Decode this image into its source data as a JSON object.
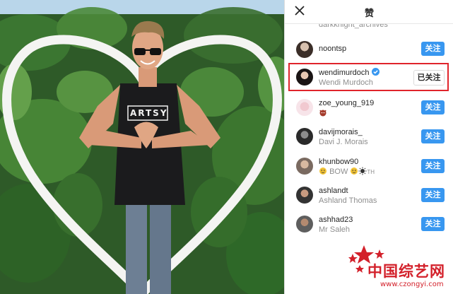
{
  "panel": {
    "title": "赞",
    "close_icon": "close-icon"
  },
  "likers": [
    {
      "username": "darkknight_archives",
      "subtitle": "",
      "button": "",
      "partial": true
    },
    {
      "username": "noontsp",
      "subtitle": "",
      "button": "关注"
    },
    {
      "username": "wendimurdoch",
      "subtitle": "Wendi Murdoch",
      "button": "已关注",
      "verified": true,
      "highlighted": true
    },
    {
      "username": "zoe_young_919",
      "subtitle": "",
      "button": "关注",
      "sub_icons": [
        "devil-emoji-icon"
      ]
    },
    {
      "username": "davijmorais_",
      "subtitle": "Davi J. Morais",
      "button": "关注"
    },
    {
      "username": "khunbow90",
      "subtitle": "BOW",
      "subtitle_suffix": "TH",
      "button": "关注",
      "sub_icons": [
        "face-emoji-icon",
        "face-emoji-icon",
        "sun-emoji-icon"
      ]
    },
    {
      "username": "ashlandt",
      "subtitle": "Ashland Thomas",
      "button": "关注"
    },
    {
      "username": "ashhad23",
      "subtitle": "Mr Saleh",
      "button": "关注"
    }
  ],
  "photo": {
    "shirt_text": "ARTSY"
  },
  "watermark": {
    "text": "中国综艺网",
    "url": "www.czongyi.com",
    "brand_color": "#d3202a"
  },
  "colors": {
    "accent": "#3897f0",
    "highlight": "#e0242b"
  }
}
